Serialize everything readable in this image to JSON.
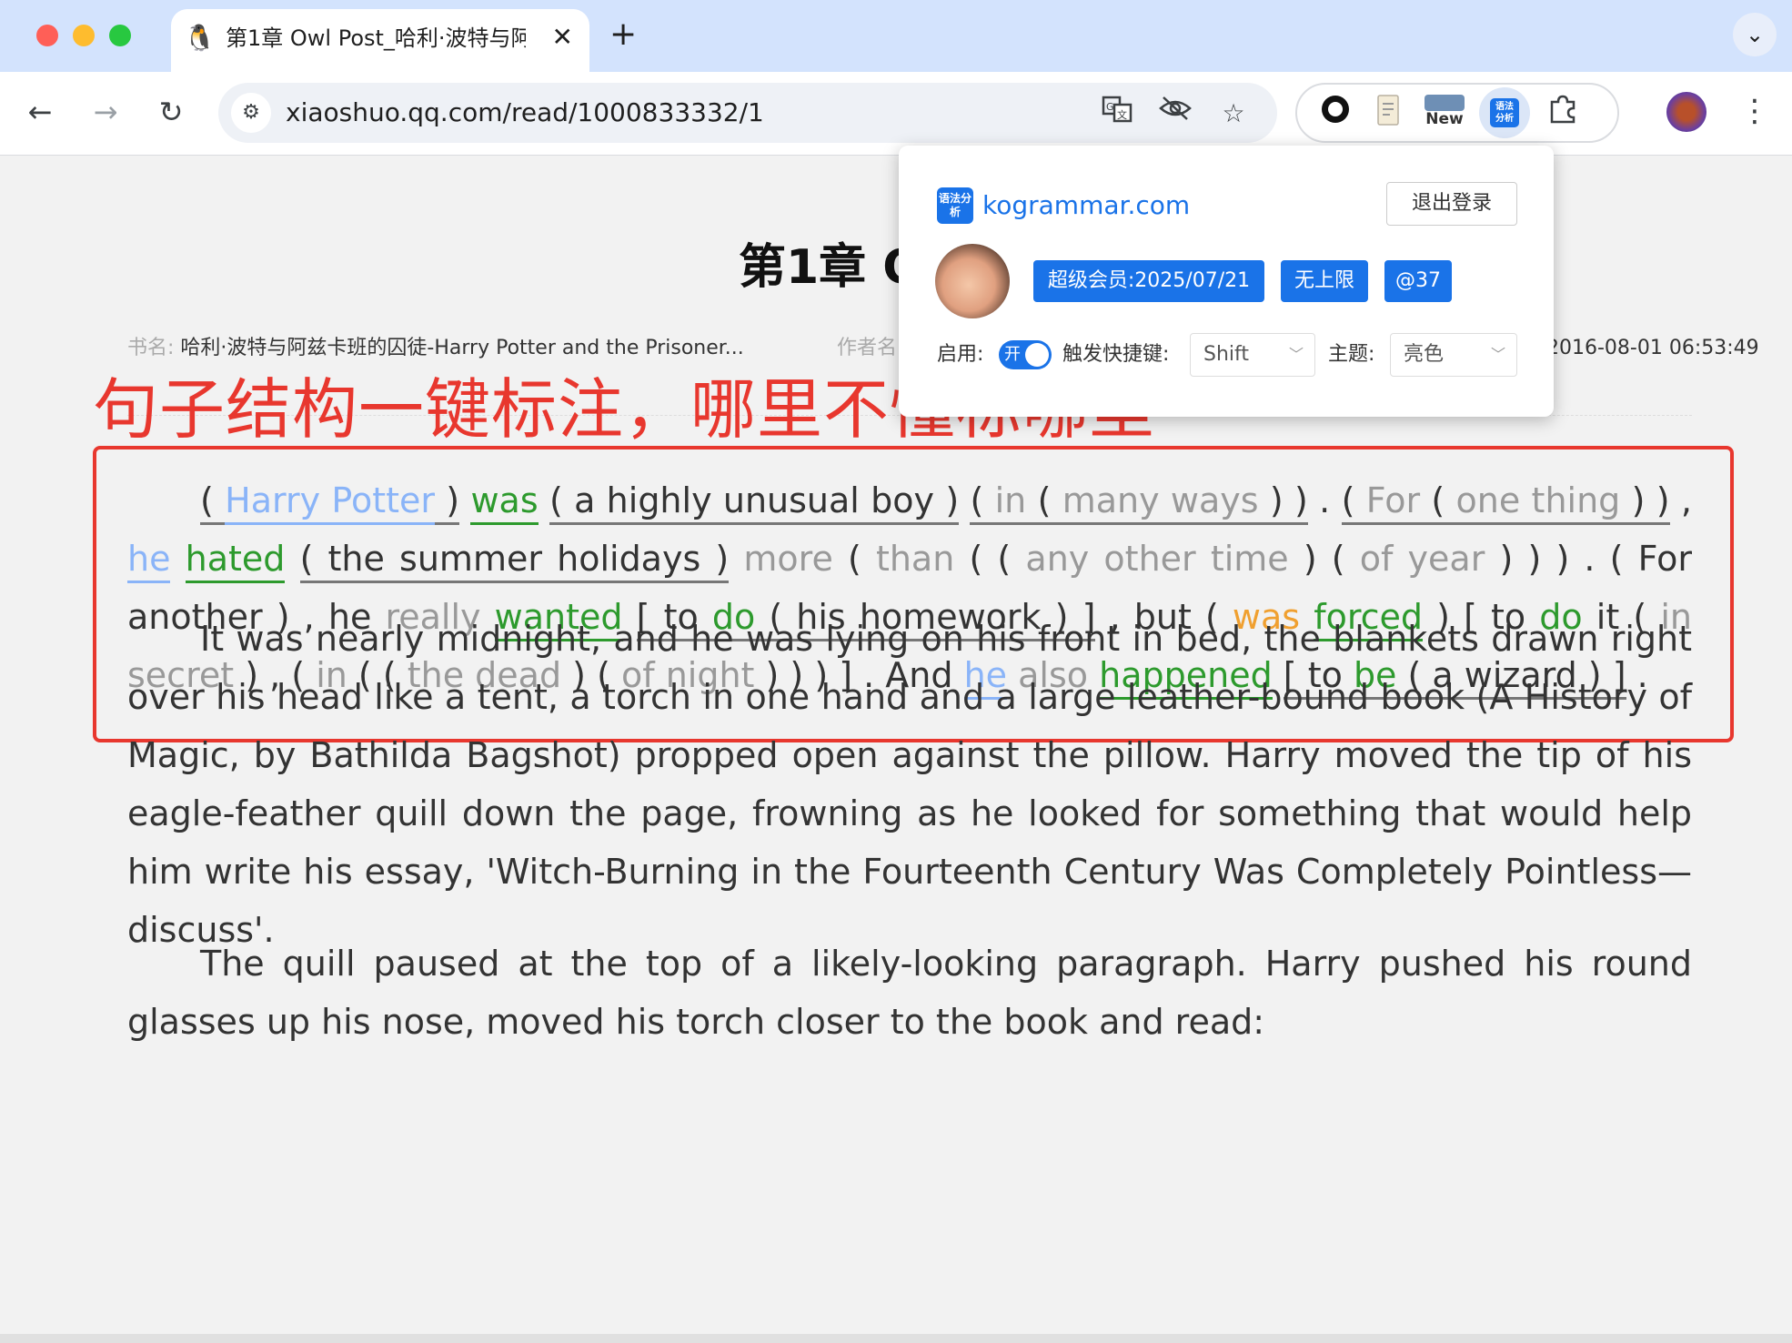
{
  "browser": {
    "tab": {
      "title": "第1章 Owl Post_哈利·波特与阿",
      "close": "✕",
      "favicon": "🐧"
    },
    "new_tab": "+",
    "tab_menu": "⌄",
    "url": "xiaoshuo.qq.com/read/1000833332/1",
    "ext_new_label": "New",
    "kebab": "⋮"
  },
  "page": {
    "chapter_title": "第1章 O",
    "meta": {
      "book_label": "书名:",
      "book_name": "哈利·波特与阿兹卡班的囚徒-Harry Potter and the Prisoner...",
      "author_label": "作者名",
      "date": "2016-08-01 06:53:49"
    },
    "promo_heading": "句子结构一键标注，哪里不懂标哪里",
    "paragraphs": [
      "It was nearly midnight, and he was lying on his front in bed, the blankets drawn right over his head like a tent, a torch in one hand and a large leather-bound book (A History of Magic, by Bathilda Bagshot) propped open against the pillow. Harry moved the tip of his eagle-feather quill down the page, frowning as he looked for something that would help him write his essay, 'Witch-Burning in the Fourteenth Century Was Completely Pointless—discuss'.",
      "The quill paused at the top of a likely-looking paragraph. Harry pushed his round glasses up his nose, moved his torch closer to the book and read:"
    ]
  },
  "popup": {
    "logo_text": "语法分析",
    "site": "kogrammar.com",
    "logout": "退出登录",
    "badges": [
      "超级会员:2025/07/21",
      "无上限",
      "@37"
    ],
    "enable_label": "启用:",
    "toggle_text": "开",
    "hotkey_label": "触发快捷键:",
    "hotkey_value": "Shift",
    "theme_label": "主题:",
    "theme_value": "亮色"
  },
  "colors": {
    "accent": "#1a73e8",
    "promo_red": "#e8372e",
    "verb_green": "#2d9a2d",
    "subject_blue": "#8ab4f8",
    "modifier_gray": "#999999",
    "aux_orange": "#f0a030"
  }
}
